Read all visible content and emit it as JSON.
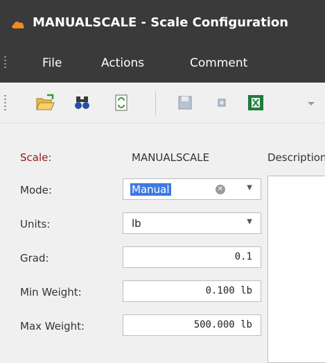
{
  "window": {
    "title": "MANUALSCALE - Scale Configuration"
  },
  "menu": {
    "file": "File",
    "actions": "Actions",
    "comment": "Comment"
  },
  "toolbar": {
    "icons": [
      "open-folder-icon",
      "binoculars-icon",
      "refresh-icon",
      "save-icon",
      "delete-icon",
      "excel-export-icon",
      "dropdown-arrow-icon"
    ]
  },
  "form": {
    "scale": {
      "label": "Scale:",
      "value": "MANUALSCALE"
    },
    "mode": {
      "label": "Mode:",
      "value": "Manual"
    },
    "units": {
      "label": "Units:",
      "value": "lb"
    },
    "grad": {
      "label": "Grad:",
      "value": "0.1"
    },
    "min_weight": {
      "label": "Min Weight:",
      "value": "0.100 lb"
    },
    "max_weight": {
      "label": "Max Weight:",
      "value": "500.000 lb"
    },
    "description": {
      "label": "Description"
    }
  },
  "colors": {
    "titlebar": "#3a3a3a",
    "accent_orange": "#f08a24",
    "selection": "#3d7ae0",
    "required_label": "#8b1a1a"
  }
}
